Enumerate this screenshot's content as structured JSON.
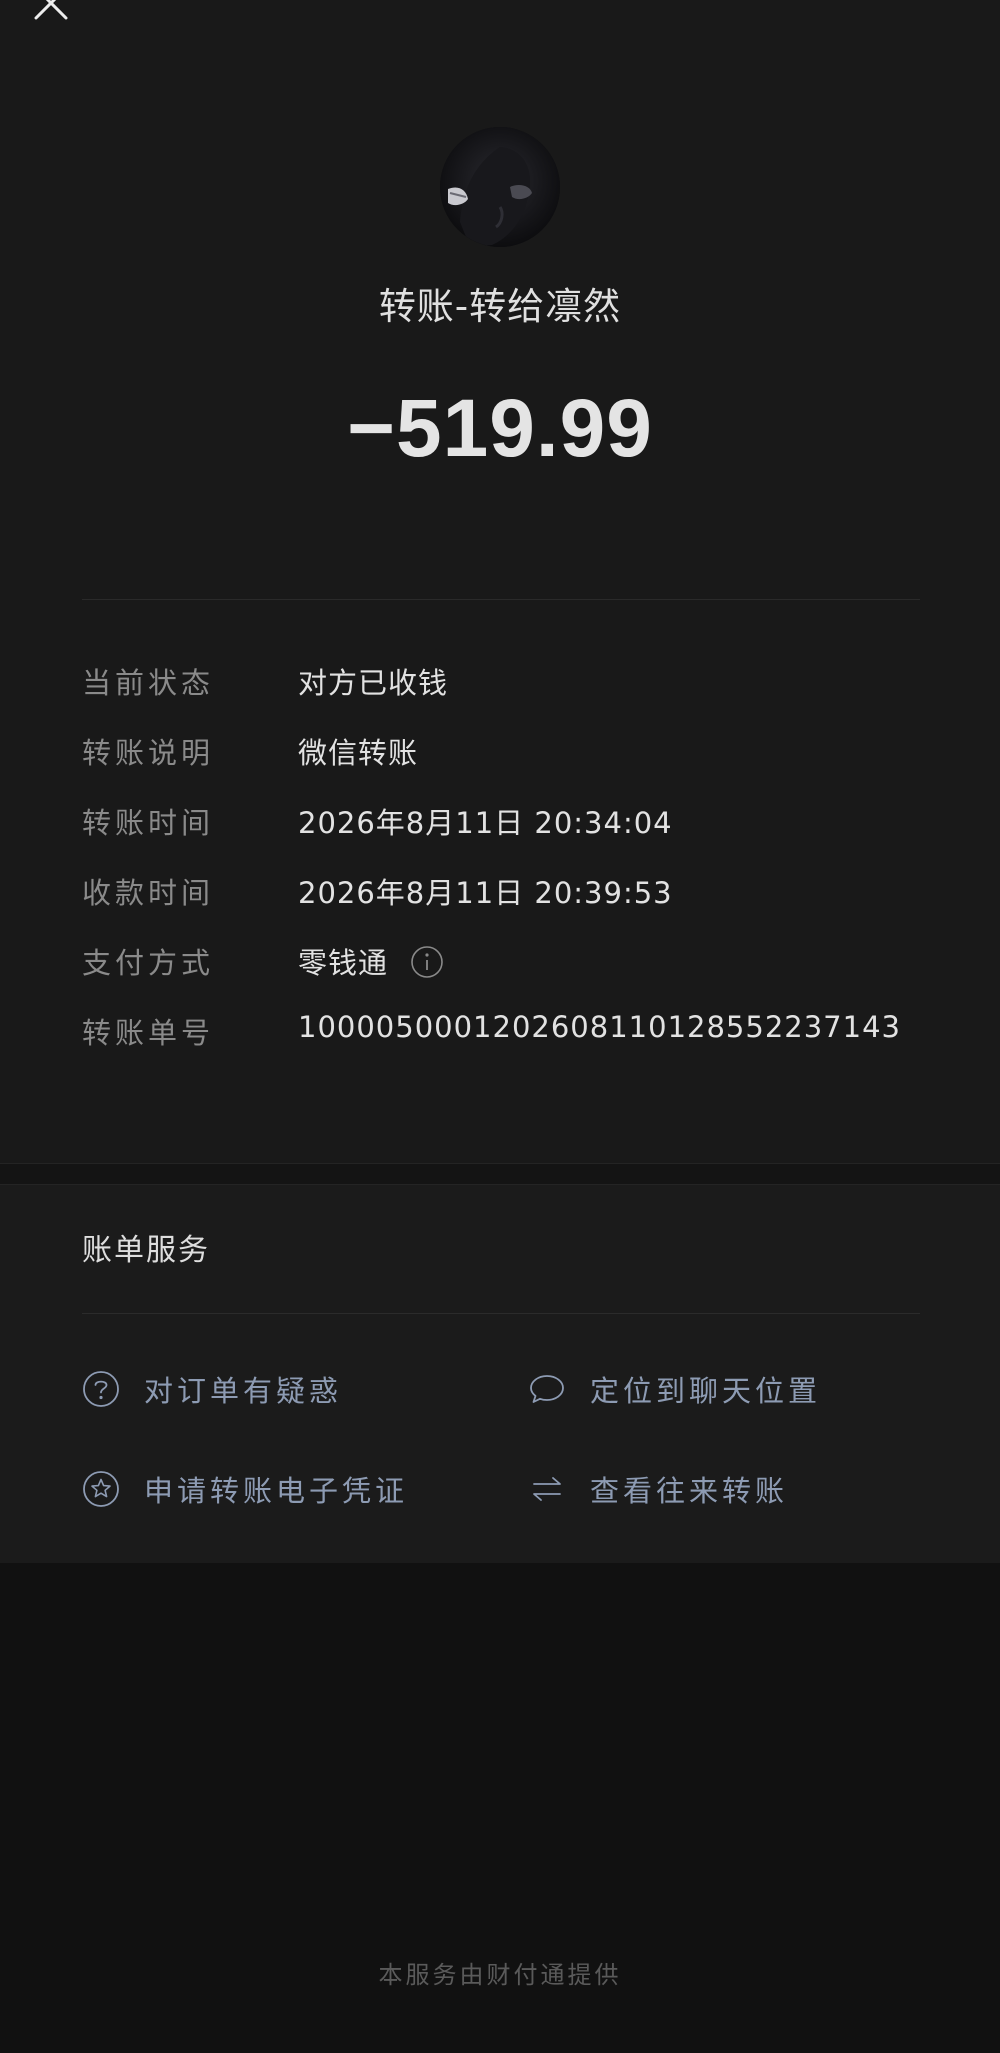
{
  "header": {
    "close_icon": "close-icon",
    "title": "转账-转给凛然",
    "amount": "−519.99"
  },
  "details": [
    {
      "label": "当前状态",
      "value": "对方已收钱"
    },
    {
      "label": "转账说明",
      "value": "微信转账"
    },
    {
      "label": "转账时间",
      "value": "2026年8月11日 20:34:04"
    },
    {
      "label": "收款时间",
      "value": "2026年8月11日 20:39:53"
    },
    {
      "label": "支付方式",
      "value": "零钱通",
      "icon": "info-icon"
    },
    {
      "label": "转账单号",
      "value": "1000050001202608110128552237143"
    }
  ],
  "service": {
    "title": "账单服务",
    "items": [
      {
        "label": "对订单有疑惑",
        "icon": "question-circle-icon"
      },
      {
        "label": "定位到聊天位置",
        "icon": "chat-bubble-icon"
      },
      {
        "label": "申请转账电子凭证",
        "icon": "star-circle-icon"
      },
      {
        "label": "查看往来转账",
        "icon": "exchange-arrows-icon"
      }
    ]
  },
  "footer": {
    "text": "本服务由财付通提供"
  },
  "colors": {
    "background": "#111111",
    "panel": "#191919",
    "link": "#8d9bb3",
    "label": "#8a8a8a"
  }
}
